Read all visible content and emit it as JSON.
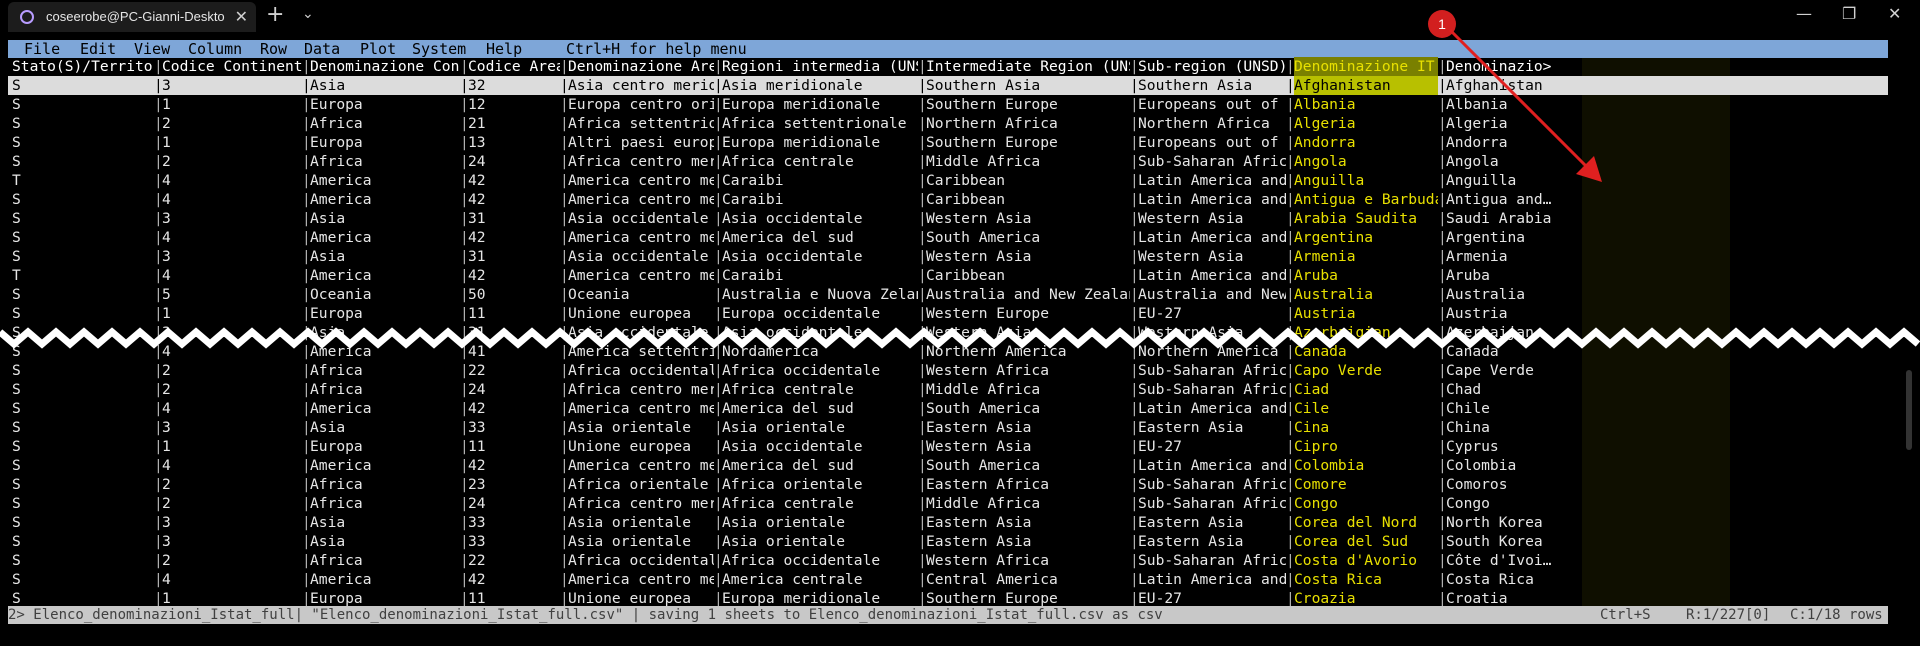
{
  "window": {
    "tab_title": "coseerobe@PC-Gianni-Deskto",
    "new_tab": "+",
    "dropdown": "⌄",
    "min": "—",
    "max": "❐",
    "close": "✕",
    "tab_close": "✕"
  },
  "menu": {
    "items": [
      "File",
      "Edit",
      "View",
      "Column",
      "Row",
      "Data",
      "Plot",
      "System",
      "Help"
    ],
    "hint": "Ctrl+H for help menu"
  },
  "headers": [
    "Stato(S)/Territori…",
    "Codice Continente",
    "Denominazione Cont…",
    "Codice Area",
    "Denominazione Area…",
    "Regioni intermedia (UNSD)",
    "Intermediate Region (UNSD)",
    "Sub-region (UNSD)",
    "Denominazione IT",
    "Denominazio>"
  ],
  "rows_top": [
    [
      "S",
      "3",
      "Asia",
      "32",
      "Asia centro meridi…",
      "Asia meridionale",
      "Southern Asia",
      "Southern Asia",
      "Afghanistan",
      "Afghanistan"
    ],
    [
      "S",
      "1",
      "Europa",
      "12",
      "Europa centro orie…",
      "Europa meridionale",
      "Southern Europe",
      "Europeans out of EU",
      "Albania",
      "Albania"
    ],
    [
      "S",
      "2",
      "Africa",
      "21",
      "Africa settentrion…",
      "Africa settentrionale",
      "Northern Africa",
      "Northern Africa",
      "Algeria",
      "Algeria"
    ],
    [
      "S",
      "1",
      "Europa",
      "13",
      "Altri paesi europei",
      "Europa meridionale",
      "Southern Europe",
      "Europeans out of EU",
      "Andorra",
      "Andorra"
    ],
    [
      "S",
      "2",
      "Africa",
      "24",
      "Africa centro meri…",
      "Africa centrale",
      "Middle Africa",
      "Sub-Saharan Africa",
      "Angola",
      "Angola"
    ],
    [
      "T",
      "4",
      "America",
      "42",
      "America centro mer…",
      "Caraibi",
      "Caribbean",
      "Latin America and …",
      "Anguilla",
      "Anguilla"
    ],
    [
      "S",
      "4",
      "America",
      "42",
      "America centro mer…",
      "Caraibi",
      "Caribbean",
      "Latin America and …",
      "Antigua e Barbuda",
      "Antigua and…"
    ],
    [
      "S",
      "3",
      "Asia",
      "31",
      "Asia occidentale",
      "Asia occidentale",
      "Western Asia",
      "Western Asia",
      "Arabia Saudita",
      "Saudi Arabia"
    ],
    [
      "S",
      "4",
      "America",
      "42",
      "America centro mer…",
      "America del sud",
      "South America",
      "Latin America and …",
      "Argentina",
      "Argentina"
    ],
    [
      "S",
      "3",
      "Asia",
      "31",
      "Asia occidentale",
      "Asia occidentale",
      "Western Asia",
      "Western Asia",
      "Armenia",
      "Armenia"
    ],
    [
      "T",
      "4",
      "America",
      "42",
      "America centro mer…",
      "Caraibi",
      "Caribbean",
      "Latin America and …",
      "Aruba",
      "Aruba"
    ],
    [
      "S",
      "5",
      "Oceania",
      "50",
      "Oceania",
      "Australia e Nuova Zelanda",
      "Australia and New Zealand",
      "Australia and New …",
      "Australia",
      "Australia"
    ],
    [
      "S",
      "1",
      "Europa",
      "11",
      "Unione europea",
      "Europa occidentale",
      "Western Europe",
      "EU-27",
      "Austria",
      "Austria"
    ],
    [
      "S",
      "3",
      "Asia",
      "31",
      "Asia occidentale",
      "Asia occidentale",
      "Western Asia",
      "Western Asia",
      "Azerbaigian",
      "Azerbaijan"
    ]
  ],
  "rows_bottom": [
    [
      "S",
      "4",
      "America",
      "41",
      "America settentrio…",
      "Nordamerica",
      "Northern America",
      "Northern America",
      "Canada",
      "Canada"
    ],
    [
      "S",
      "2",
      "Africa",
      "22",
      "Africa occidentale",
      "Africa occidentale",
      "Western Africa",
      "Sub-Saharan Africa",
      "Capo Verde",
      "Cape Verde"
    ],
    [
      "S",
      "2",
      "Africa",
      "24",
      "Africa centro meri…",
      "Africa centrale",
      "Middle Africa",
      "Sub-Saharan Africa",
      "Ciad",
      "Chad"
    ],
    [
      "S",
      "4",
      "America",
      "42",
      "America centro mer…",
      "America del sud",
      "South America",
      "Latin America and …",
      "Cile",
      "Chile"
    ],
    [
      "S",
      "3",
      "Asia",
      "33",
      "Asia orientale",
      "Asia orientale",
      "Eastern Asia",
      "Eastern Asia",
      "Cina",
      "China"
    ],
    [
      "S",
      "1",
      "Europa",
      "11",
      "Unione europea",
      "Asia occidentale",
      "Western Asia",
      "EU-27",
      "Cipro",
      "Cyprus"
    ],
    [
      "S",
      "4",
      "America",
      "42",
      "America centro mer…",
      "America del sud",
      "South America",
      "Latin America and …",
      "Colombia",
      "Colombia"
    ],
    [
      "S",
      "2",
      "Africa",
      "23",
      "Africa orientale",
      "Africa orientale",
      "Eastern Africa",
      "Sub-Saharan Africa",
      "Comore",
      "Comoros"
    ],
    [
      "S",
      "2",
      "Africa",
      "24",
      "Africa centro meri…",
      "Africa centrale",
      "Middle Africa",
      "Sub-Saharan Africa",
      "Congo",
      "Congo"
    ],
    [
      "S",
      "3",
      "Asia",
      "33",
      "Asia orientale",
      "Asia orientale",
      "Eastern Asia",
      "Eastern Asia",
      "Corea del Nord",
      "North Korea"
    ],
    [
      "S",
      "3",
      "Asia",
      "33",
      "Asia orientale",
      "Asia orientale",
      "Eastern Asia",
      "Eastern Asia",
      "Corea del Sud",
      "South Korea"
    ],
    [
      "S",
      "2",
      "Africa",
      "22",
      "Africa occidentale",
      "Africa occidentale",
      "Western Africa",
      "Sub-Saharan Africa",
      "Costa d'Avorio",
      "Côte d'Ivoi…"
    ],
    [
      "S",
      "4",
      "America",
      "42",
      "America centro mer…",
      "America centrale",
      "Central America",
      "Latin America and …",
      "Costa Rica",
      "Costa Rica"
    ],
    [
      "S",
      "1",
      "Europa",
      "11",
      "Unione europea",
      "Europa meridionale",
      "Southern Europe",
      "EU-27",
      "Croazia",
      "Croatia"
    ]
  ],
  "status": {
    "left": "2> Elenco_denominazioni_Istat_full| \"Elenco_denominazioni_Istat_full.csv\" | saving 1 sheets to Elenco_denominazioni_Istat_full.csv as csv",
    "keys": "Ctrl+S",
    "pos": "R:1/227[0]",
    "cols": "C:1/18 rows"
  },
  "annotation": {
    "badge": "1"
  },
  "colors": {
    "menubar": "#7ea6d8",
    "highlight": "#b8c000",
    "it_text": "#e8e000",
    "annotation": "#d21f1f"
  }
}
